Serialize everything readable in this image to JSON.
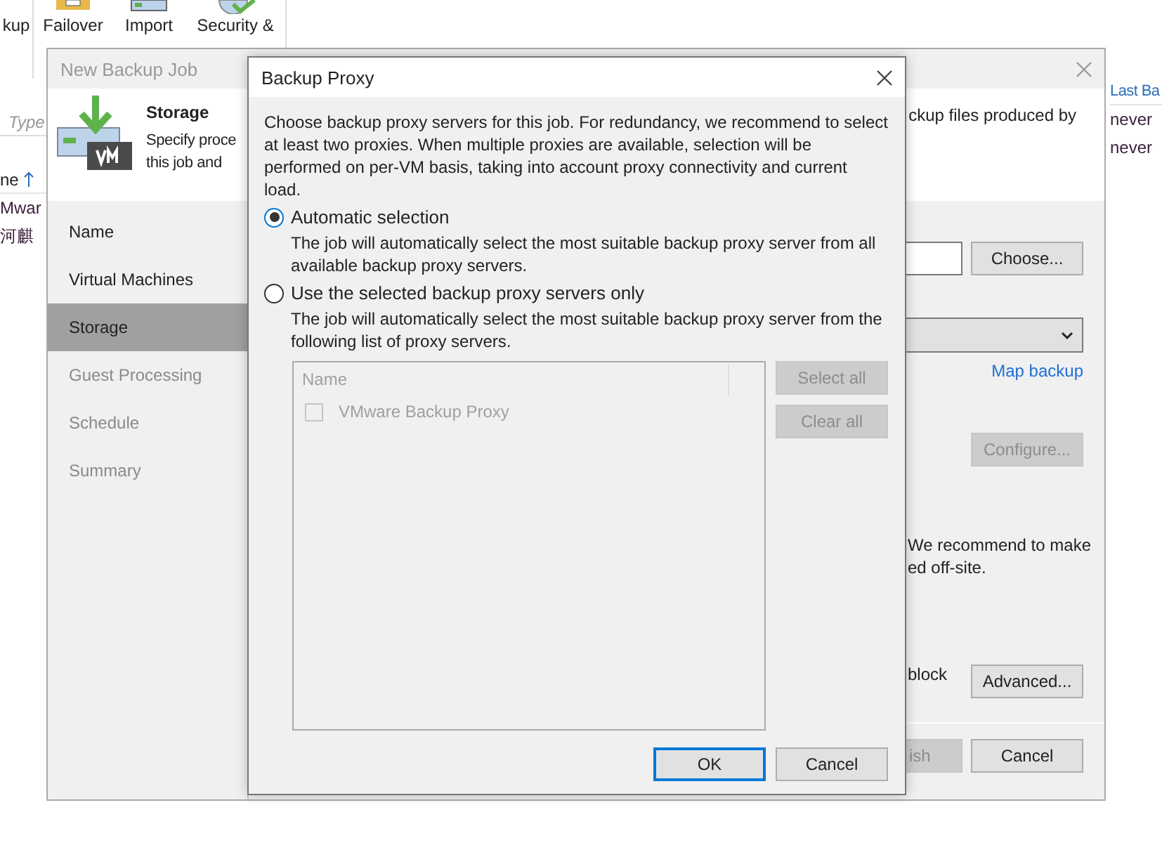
{
  "background_app": {
    "ribbon": [
      {
        "label": "kup"
      },
      {
        "label": "Failover"
      },
      {
        "label": "Import"
      },
      {
        "label": "Security &"
      }
    ],
    "search": {
      "placeholder": "Type"
    },
    "left_column": {
      "header": "ne",
      "rows": [
        "Mwar",
        "河麒"
      ]
    },
    "right_column": {
      "header": "Last Ba",
      "rows": [
        "never",
        "never"
      ]
    }
  },
  "wizard": {
    "title": "New Backup Job",
    "step_title": "Storage",
    "step_description_lines": [
      "Specify proce",
      "this job and"
    ],
    "step_description_right": "ckup files produced by",
    "steps": [
      {
        "label": "Name",
        "selected": false,
        "disabled": false
      },
      {
        "label": "Virtual Machines",
        "selected": false,
        "disabled": false
      },
      {
        "label": "Storage",
        "selected": true,
        "disabled": false
      },
      {
        "label": "Guest Processing",
        "selected": false,
        "disabled": true
      },
      {
        "label": "Schedule",
        "selected": false,
        "disabled": true
      },
      {
        "label": "Summary",
        "selected": false,
        "disabled": true
      }
    ],
    "choose_button": "Choose...",
    "map_backup_link": "Map backup",
    "configure_button": {
      "label": "Configure...",
      "disabled": true
    },
    "note_lines": [
      "We recommend to make",
      "ed off-site."
    ],
    "block_text": "block",
    "advanced_button": "Advanced...",
    "finish_button": {
      "label": "ish",
      "disabled": true
    },
    "cancel_button": "Cancel"
  },
  "dialog": {
    "title": "Backup Proxy",
    "description": "Choose backup proxy servers for this job. For redundancy, we recommend to select at least two proxies. When multiple proxies are available, selection will be performed on per-VM basis, taking into account proxy connectivity and current load.",
    "options": [
      {
        "label": "Automatic selection",
        "selected": true,
        "hint": "The job will automatically select the most suitable backup proxy server from all available backup proxy servers."
      },
      {
        "label": "Use the selected backup proxy servers only",
        "selected": false,
        "hint": "The job will automatically select the most suitable backup proxy server from the following list of proxy servers."
      }
    ],
    "proxy_list": {
      "disabled": true,
      "column": "Name",
      "rows": [
        {
          "name": "VMware Backup Proxy",
          "checked": false
        }
      ]
    },
    "select_all_button": {
      "label": "Select all",
      "disabled": true
    },
    "clear_all_button": {
      "label": "Clear all",
      "disabled": true
    },
    "ok_button": {
      "label": "OK",
      "focused": true
    },
    "cancel_button": "Cancel"
  }
}
